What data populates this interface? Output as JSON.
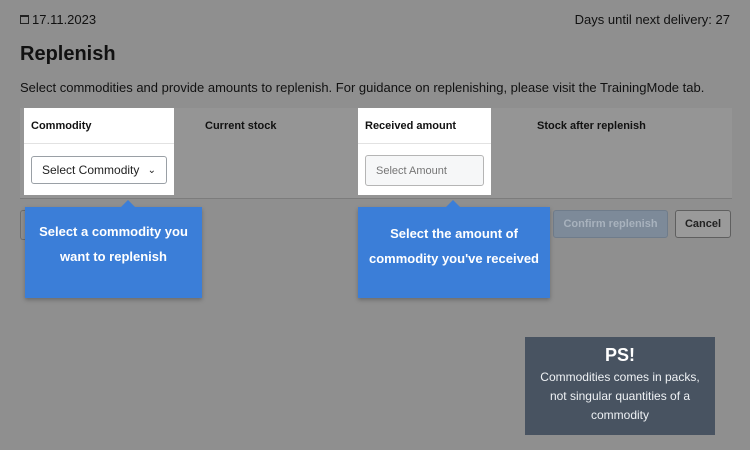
{
  "header": {
    "date_icon": "calendar-icon",
    "date": "17.11.2023",
    "delivery_text": "Days until next delivery: 27"
  },
  "page": {
    "title": "Replenish",
    "description": "Select commodities and provide amounts to replenish. For guidance on replenishing, please visit the TrainingMode tab."
  },
  "table": {
    "headers": [
      "Commodity",
      "Current stock",
      "Received amount",
      "Stock after replenish"
    ],
    "commodity_select_label": "Select Commodity",
    "amount_placeholder": "Select Amount"
  },
  "buttons": {
    "confirm": "Confirm replenish",
    "cancel": "Cancel"
  },
  "tooltips": {
    "commodity": [
      "Select a commodity you",
      "want to replenish"
    ],
    "amount": [
      "Select the amount of",
      "commodity you've received"
    ]
  },
  "ps": {
    "title": "PS!",
    "lines": [
      "Commodities comes in packs,",
      "not singular quantities of a",
      "commodity"
    ]
  },
  "colors": {
    "tooltip_blue": "#3b7ed8",
    "ps_box": "#485361",
    "overlay_gray": "#8f8f8f"
  }
}
